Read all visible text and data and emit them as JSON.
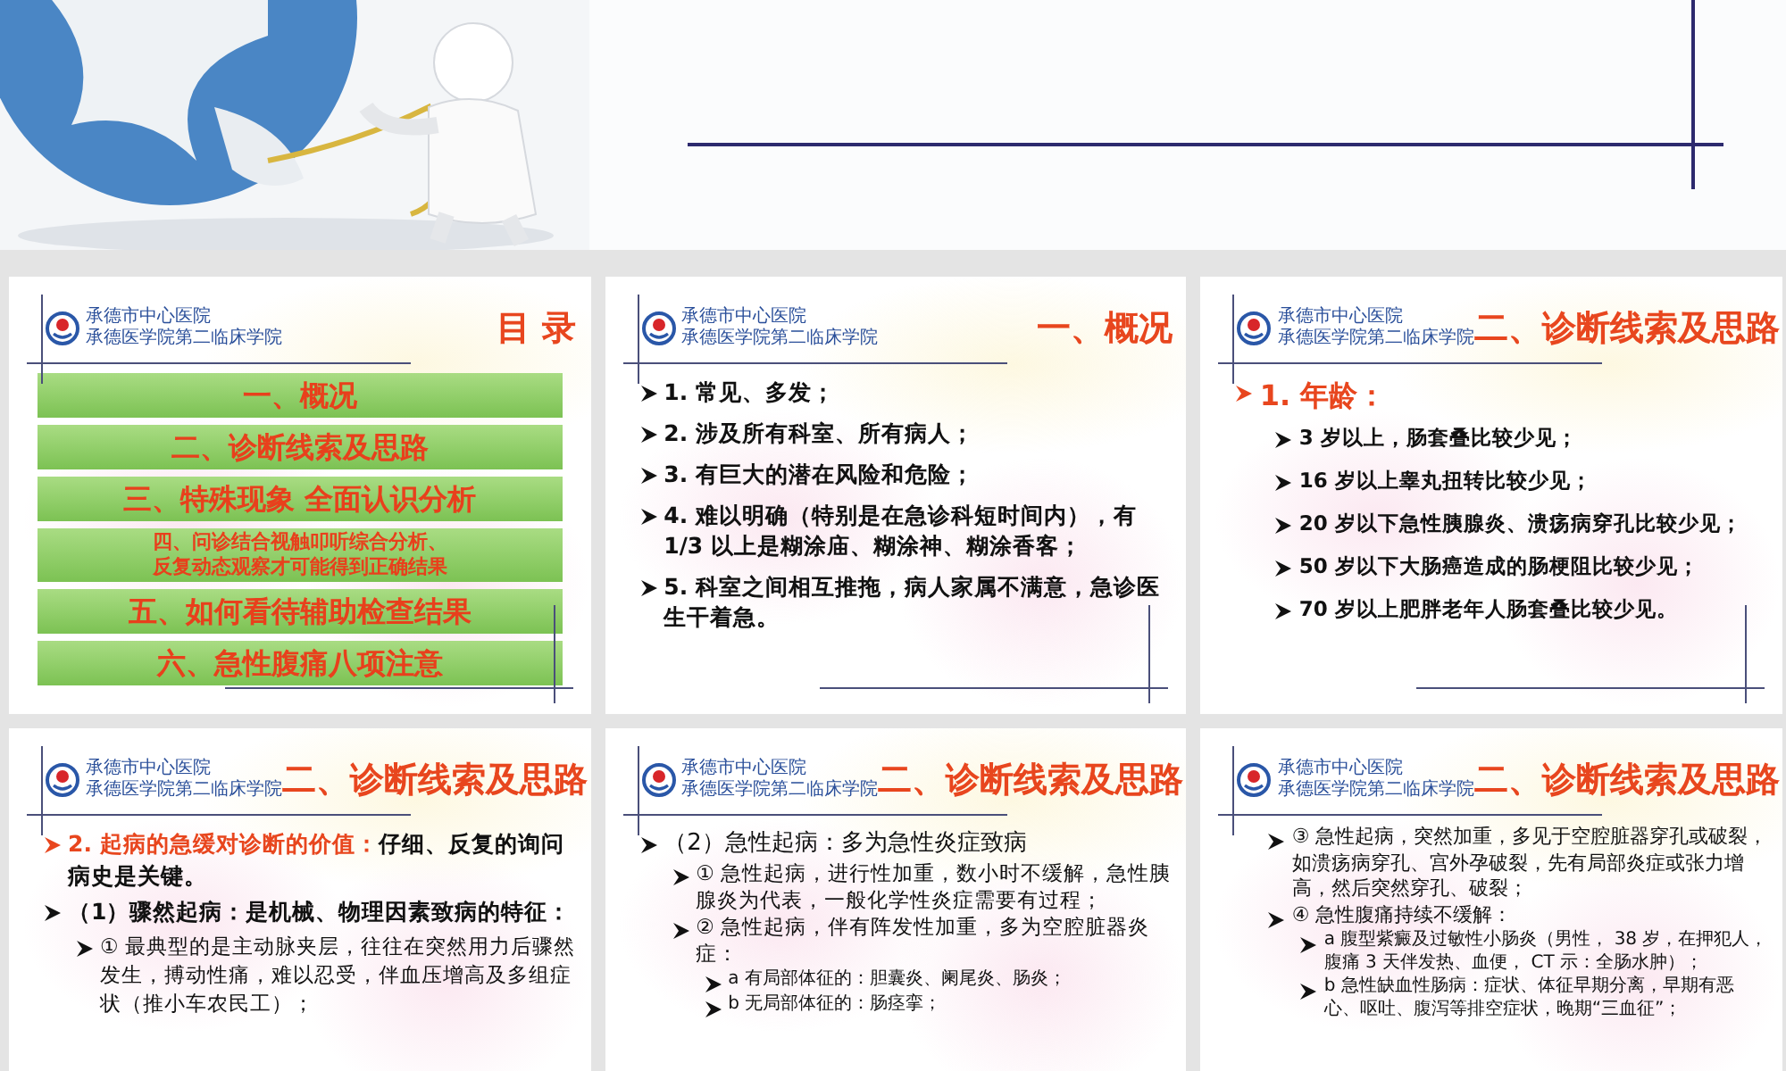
{
  "slides": [
    {
      "kind": "toc",
      "logo": [
        "承德市中心医院",
        "承德医学院第二临床学院"
      ],
      "title": "目 录",
      "entries": [
        {
          "lines": [
            "一、概况"
          ]
        },
        {
          "lines": [
            "二、诊断线索及思路"
          ]
        },
        {
          "lines": [
            "三、特殊现象  全面认识分析"
          ]
        },
        {
          "lines": [
            "四、问诊结合视触叩听综合分析、",
            "反复动态观察才可能得到正确结果"
          ]
        },
        {
          "lines": [
            "五、如何看待辅助检查结果"
          ]
        },
        {
          "lines": [
            "六、急性腹痛八项注意"
          ]
        }
      ]
    },
    {
      "kind": "content",
      "logo": [
        "承德市中心医院",
        "承德医学院第二临床学院"
      ],
      "title": "一、概况",
      "items": [
        {
          "text": "1. 常见、多发；"
        },
        {
          "text": "2. 涉及所有科室、所有病人；"
        },
        {
          "text": "3. 有巨大的潜在风险和危险；"
        },
        {
          "text": "4. 难以明确（特别是在急诊科短时间内），有 1/3 以上是糊涂庙、糊涂神、糊涂香客；"
        },
        {
          "text": "5. 科室之间相互推拖，病人家属不满意，急诊医生干着急。"
        }
      ]
    },
    {
      "kind": "content",
      "logo": [
        "承德市中心医院",
        "承德医学院第二临床学院"
      ],
      "title": "二、诊断线索及思路",
      "items": [
        {
          "lead": "1. 年龄：",
          "children": [
            {
              "text": "3 岁以上，肠套叠比较少见；"
            },
            {
              "text": "16 岁以上睾丸扭转比较少见；"
            },
            {
              "text": "20 岁以下急性胰腺炎、溃疡病穿孔比较少见；"
            },
            {
              "text": "50 岁以下大肠癌造成的肠梗阻比较少见；"
            },
            {
              "text": "70 岁以上肥胖老年人肠套叠比较少见。"
            }
          ]
        }
      ]
    },
    {
      "kind": "content",
      "logo": [
        "承德市中心医院",
        "承德医学院第二临床学院"
      ],
      "title": "二、诊断线索及思路",
      "items": [
        {
          "lead": "2. 起病的急缓对诊断的价值：",
          "text": "仔细、反复的询问病史是关键。"
        },
        {
          "text": "（1）骤然起病：是机械、物理因素致病的特征：",
          "children": [
            {
              "text": "① 最典型的是主动脉夹层，往往在突然用力后骤然发生，搏动性痛，难以忍受，伴血压增高及多组症状（推小车农民工）；"
            }
          ]
        }
      ]
    },
    {
      "kind": "content",
      "logo": [
        "承德市中心医院",
        "承德医学院第二临床学院"
      ],
      "title": "二、诊断线索及思路",
      "items": [
        {
          "text": "（2）急性起病：多为急性炎症致病",
          "children": [
            {
              "text": "① 急性起病，进行性加重，数小时不缓解，急性胰腺炎为代表，一般化学性炎症需要有过程；"
            },
            {
              "text": "② 急性起病，伴有阵发性加重，多为空腔脏器炎症：",
              "children": [
                {
                  "text": "a 有局部体征的：胆囊炎、阑尾炎、肠炎；"
                },
                {
                  "text": "b 无局部体征的：肠痉挛；"
                }
              ]
            }
          ]
        }
      ]
    },
    {
      "kind": "content",
      "logo": [
        "承德市中心医院",
        "承德医学院第二临床学院"
      ],
      "title": "二、诊断线索及思路",
      "items": [
        {
          "children": [
            {
              "text": "③ 急性起病，突然加重，多见于空腔脏器穿孔或破裂，如溃疡病穿孔、宫外孕破裂，先有局部炎症或张力增高，然后突然穿孔、破裂；"
            },
            {
              "text": "④ 急性腹痛持续不缓解：",
              "children": [
                {
                  "text": "a 腹型紫癜及过敏性小肠炎（男性， 38 岁，在押犯人，腹痛 3 天伴发热、血便， CT 示：全肠水肿）；"
                },
                {
                  "text": "b 急性缺血性肠病：症状、体征早期分离，早期有恶心、呕吐、腹泻等排空症状，晚期“三血征”；"
                }
              ]
            }
          ]
        }
      ]
    }
  ]
}
